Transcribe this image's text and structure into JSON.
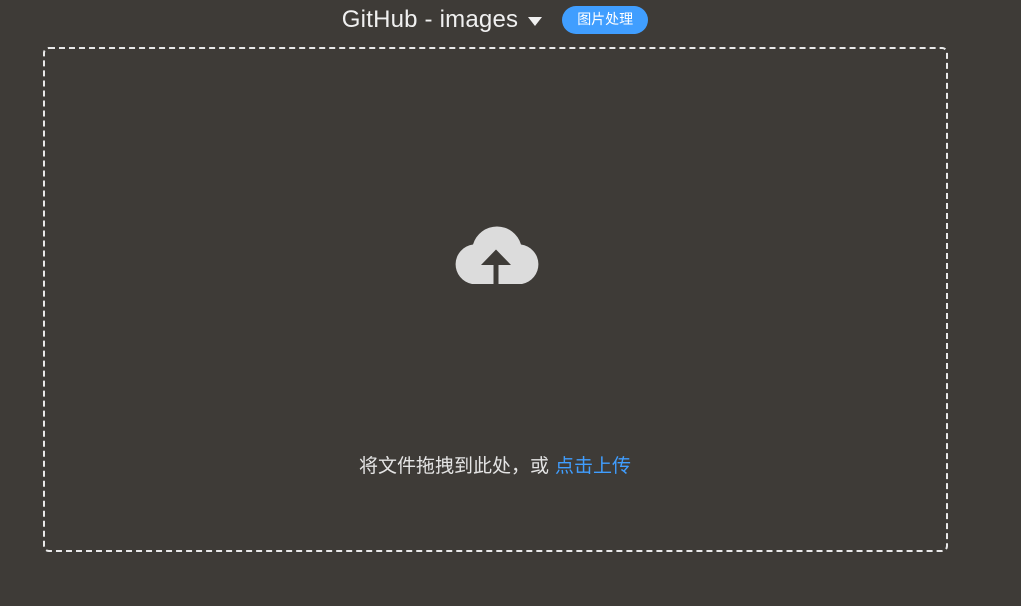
{
  "header": {
    "picbed_title": "GitHub - images",
    "process_button_label": "图片处理"
  },
  "dropzone": {
    "hint_text": "将文件拖拽到此处，或 ",
    "upload_link_label": "点击上传",
    "icon": "cloud-upload-icon"
  },
  "colors": {
    "background": "#3e3b37",
    "accent": "#409eff",
    "dashed_border": "#e9e9e9",
    "icon_fill": "#dcdcdc"
  }
}
